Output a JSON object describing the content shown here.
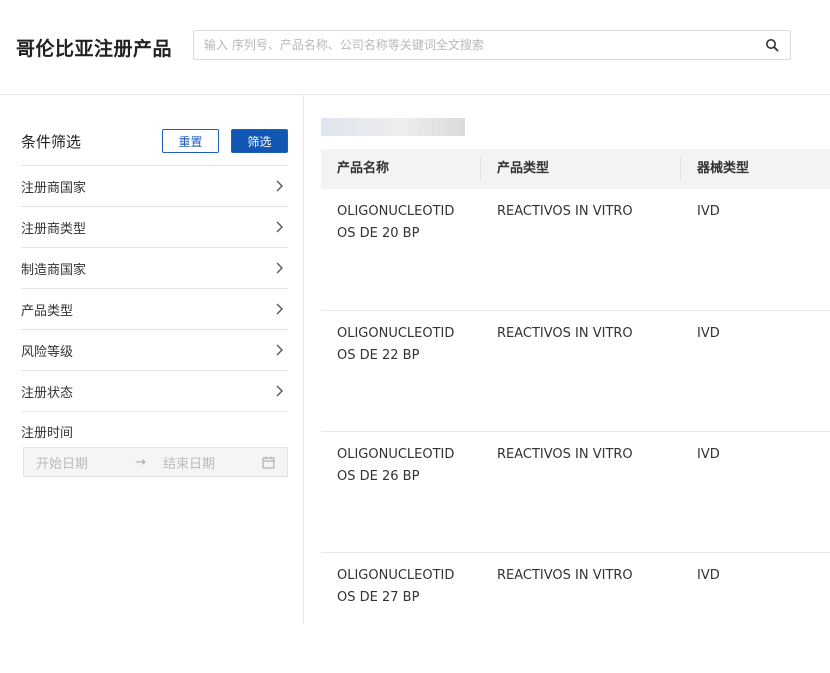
{
  "header": {
    "title": "哥伦比亚注册产品",
    "search_placeholder": "输入 序列号、产品名称、公司名称等关键词全文搜索",
    "search_value": "",
    "search_icon": "search-icon"
  },
  "sidebar": {
    "filter_title": "条件筛选",
    "reset_label": "重置",
    "filter_label": "筛选",
    "items": [
      {
        "label": "注册商国家",
        "icon": "chevron-right-icon"
      },
      {
        "label": "注册商类型",
        "icon": "chevron-right-icon"
      },
      {
        "label": "制造商国家",
        "icon": "chevron-right-icon"
      },
      {
        "label": "产品类型",
        "icon": "chevron-right-icon"
      },
      {
        "label": "风险等级",
        "icon": "chevron-right-icon"
      },
      {
        "label": "注册状态",
        "icon": "chevron-right-icon"
      }
    ],
    "date": {
      "label": "注册时间",
      "start_placeholder": "开始日期",
      "arrow": "→",
      "end_placeholder": "结束日期",
      "icon": "calendar-icon"
    }
  },
  "table": {
    "headers": [
      "产品名称",
      "产品类型",
      "器械类型"
    ],
    "rows": [
      [
        "OLIGONUCLEOTIDOS DE 20 BP",
        "REACTIVOS IN VITRO",
        "IVD"
      ],
      [
        "OLIGONUCLEOTIDOS DE 22 BP",
        "REACTIVOS IN VITRO",
        "IVD"
      ],
      [
        "OLIGONUCLEOTIDOS DE 26 BP",
        "REACTIVOS IN VITRO",
        "IVD"
      ],
      [
        "OLIGONUCLEOTIDOS DE 27 BP",
        "REACTIVOS IN VITRO",
        "IVD"
      ]
    ]
  },
  "colors": {
    "accent": "#1257b4",
    "header_bg": "#f2f3f5",
    "border": "#e8e8e8"
  }
}
